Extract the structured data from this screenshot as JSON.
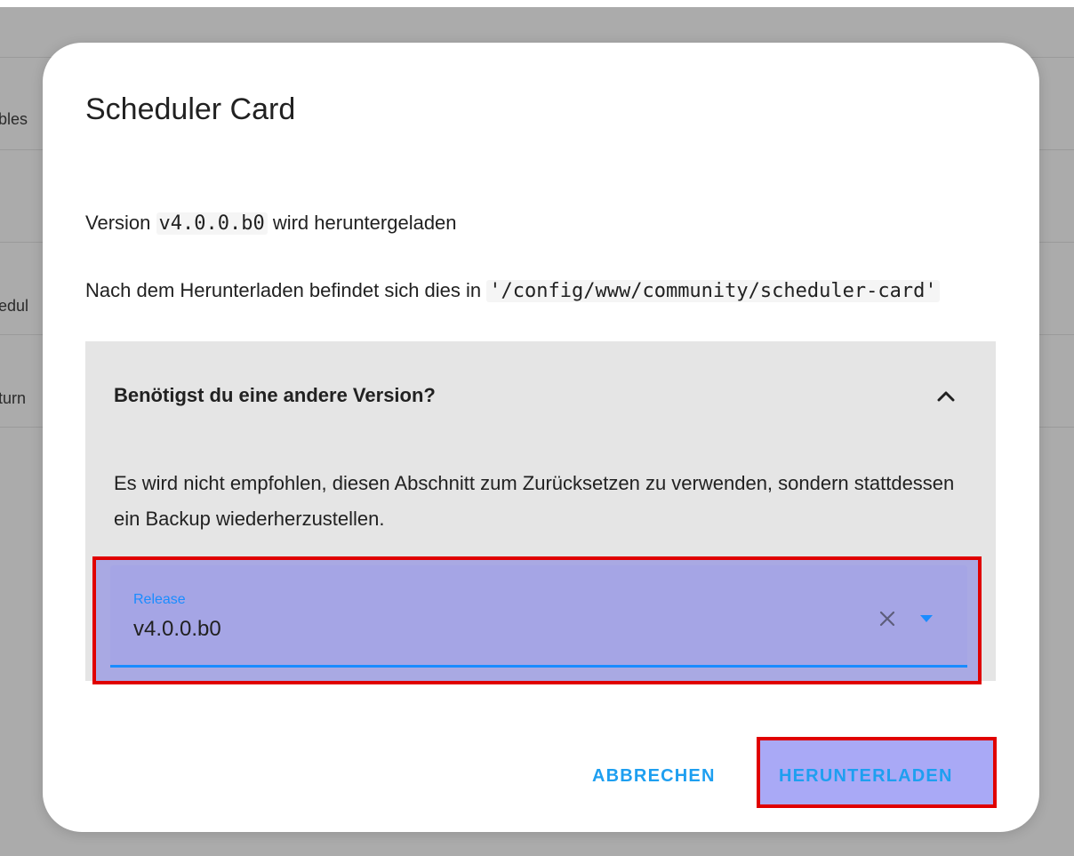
{
  "background": {
    "fragments": [
      "bles",
      "edul",
      "turn"
    ]
  },
  "dialog": {
    "title": "Scheduler Card",
    "version_prefix": "Version ",
    "version_code": "v4.0.0.b0",
    "version_suffix": " wird heruntergeladen",
    "location_prefix": "Nach dem Herunterladen befindet sich dies in ",
    "location_path": "'/config/www/community/scheduler-card'",
    "expander": {
      "title": "Benötigst du eine andere Version?",
      "expanded": true,
      "chevron_icon": "chevron-up-icon",
      "warning": "Es wird nicht empfohlen, diesen Abschnitt zum Zurücksetzen zu verwenden, sondern stattdessen ein Backup wiederherzustellen.",
      "release": {
        "label": "Release",
        "value": "v4.0.0.b0",
        "clear_icon": "close-icon",
        "dropdown_icon": "arrow-drop-down-icon"
      }
    },
    "actions": {
      "cancel_label": "ABBRECHEN",
      "download_label": "HERUNTERLADEN"
    }
  },
  "colors": {
    "accent": "#1e9ff0",
    "field_underline": "#1a8cff",
    "highlight_border": "#e00000",
    "backdrop": "#ababab"
  }
}
